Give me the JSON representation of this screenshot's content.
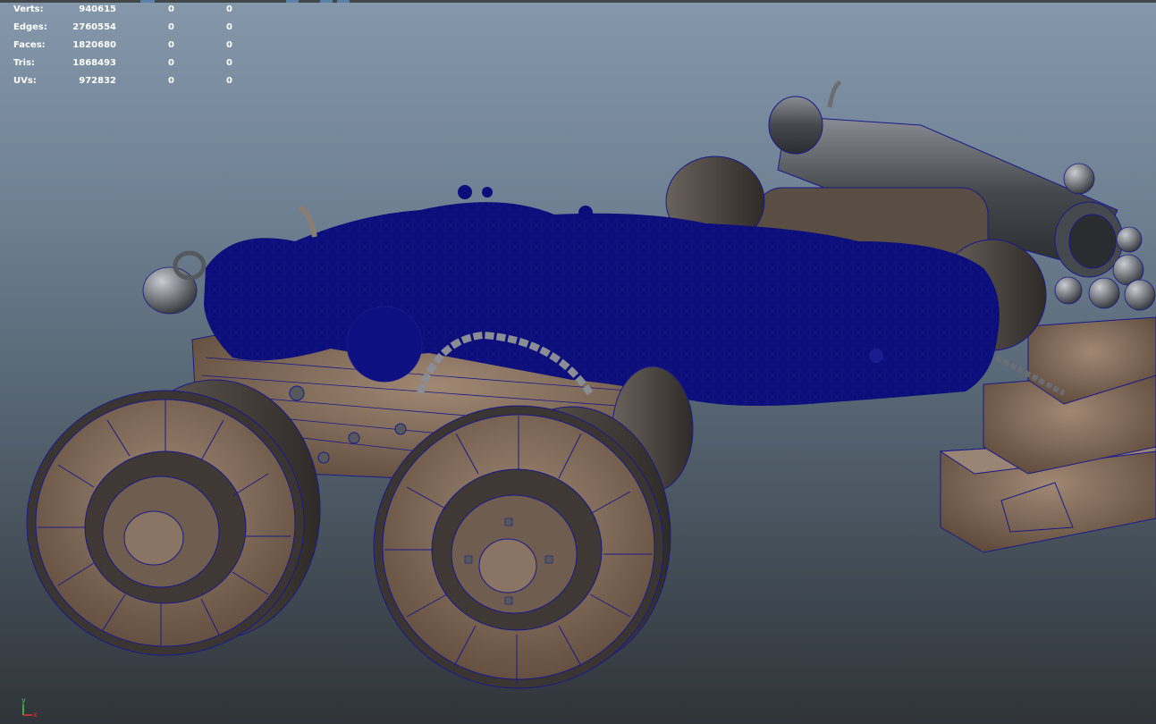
{
  "hud": {
    "rows": [
      {
        "label": "Verts:",
        "v1": "940615",
        "v2": "0",
        "v3": "0"
      },
      {
        "label": "Edges:",
        "v1": "2760554",
        "v2": "0",
        "v3": "0"
      },
      {
        "label": "Faces:",
        "v1": "1820680",
        "v2": "0",
        "v3": "0"
      },
      {
        "label": "Tris:",
        "v1": "1868493",
        "v2": "0",
        "v3": "0"
      },
      {
        "label": "UVs:",
        "v1": "972832",
        "v2": "0",
        "v3": "0"
      }
    ]
  },
  "axis": {
    "y_label": "y",
    "x_label": "x",
    "y_color": "#3fd14a",
    "x_color": "#e0353a"
  },
  "colors": {
    "wireframe": "#1a1a8a",
    "selection": "#0b0e7a",
    "wood": "#7a6656",
    "metal": "#55595e",
    "tire": "#4a4542"
  },
  "icons": [
    "axis-gizmo-icon"
  ]
}
